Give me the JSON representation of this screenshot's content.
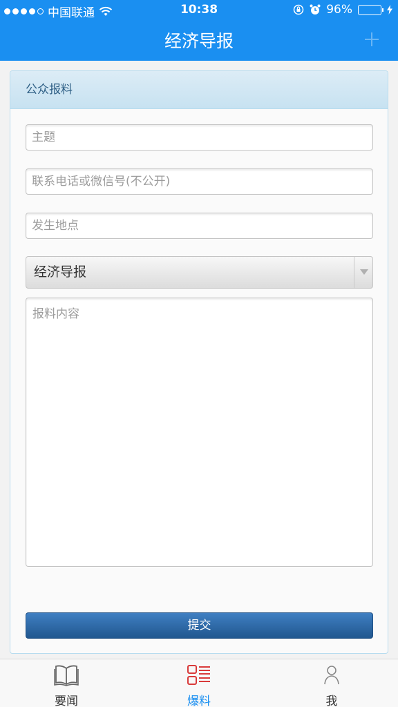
{
  "status_bar": {
    "carrier": "中国联通",
    "time": "10:38",
    "battery_percent": "96%",
    "battery_level": 0.96,
    "icons": [
      "signal-dots-icon",
      "wifi-icon",
      "rotation-lock-icon",
      "alarm-icon",
      "battery-icon",
      "charging-bolt-icon"
    ]
  },
  "nav": {
    "title": "经济导报",
    "right_icon": "plus-icon"
  },
  "form": {
    "header": "公众报料",
    "subject_placeholder": "主题",
    "contact_placeholder": "联系电话或微信号(不公开)",
    "location_placeholder": "发生地点",
    "category_selected": "经济导报",
    "content_placeholder": "报料内容",
    "submit_label": "提交"
  },
  "tabs": [
    {
      "label": "要闻",
      "icon": "book-icon",
      "active": false
    },
    {
      "label": "爆料",
      "icon": "list-icon",
      "active": true
    },
    {
      "label": "我",
      "icon": "person-icon",
      "active": false
    }
  ],
  "colors": {
    "accent": "#1a8ff1",
    "active_tab_icon": "#d93a3a",
    "submit_button": "#2b64a3"
  }
}
